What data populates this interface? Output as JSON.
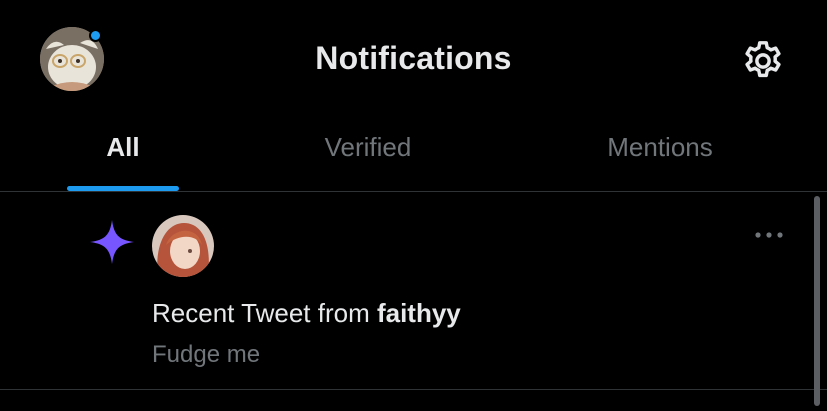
{
  "header": {
    "title": "Notifications",
    "has_unread_indicator": true,
    "icons": {
      "profile": "avatar-icon",
      "settings": "gear-icon"
    }
  },
  "tabs": [
    {
      "label": "All",
      "active": true
    },
    {
      "label": "Verified",
      "active": false
    },
    {
      "label": "Mentions",
      "active": false
    }
  ],
  "notification": {
    "prefix": "Recent Tweet from ",
    "user": "faithyy",
    "preview": "Fudge me",
    "icon": "sparkle-icon",
    "menu_icon": "more-dots-icon"
  },
  "colors": {
    "background": "#000000",
    "accent": "#1d9bf0",
    "sparkle": "#7856ff",
    "text_primary": "#e7e9ea",
    "text_secondary": "#71767b",
    "divider": "#2f3336"
  }
}
